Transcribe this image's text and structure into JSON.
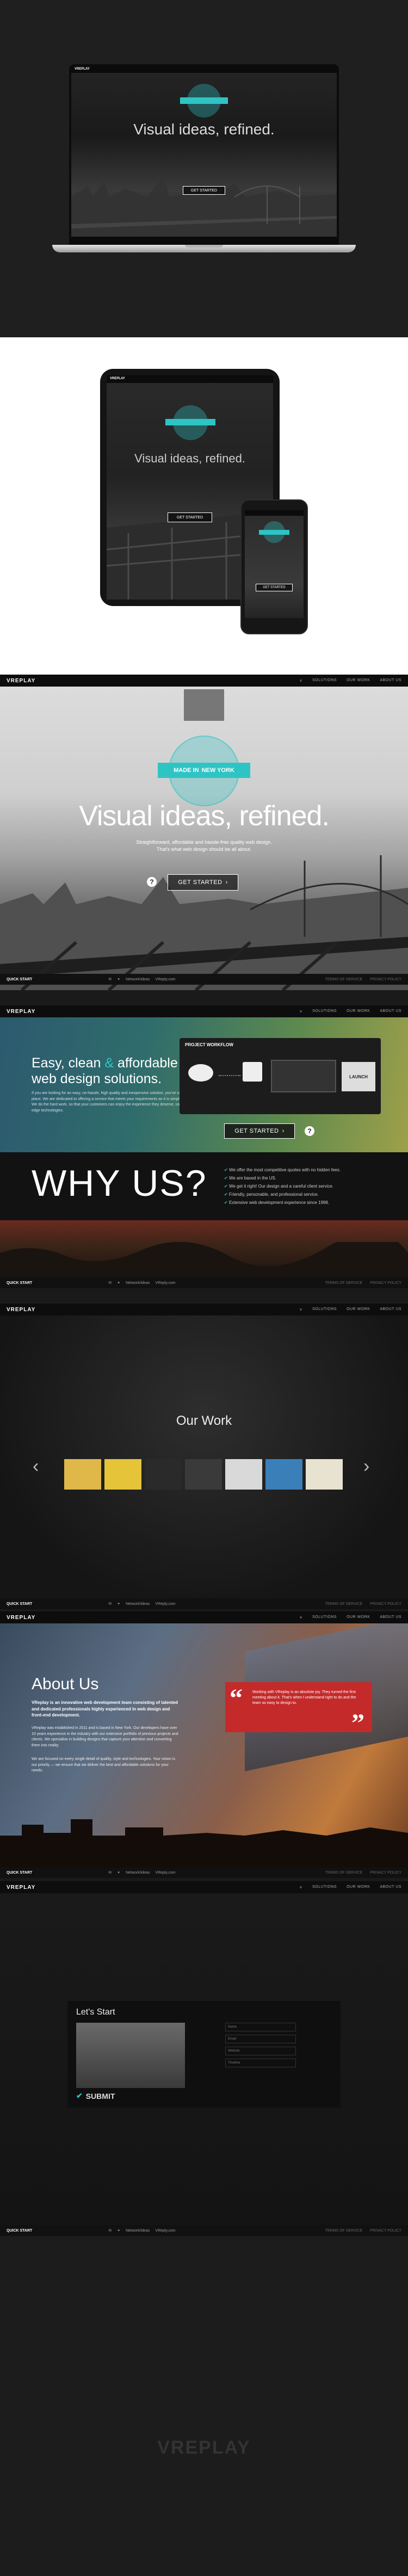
{
  "brand": "VREPLAY",
  "nav": {
    "solutions": "SOLUTIONS",
    "our_work": "OUR WORK",
    "about_us": "ABOUT US",
    "lets_start": "LET'S START"
  },
  "hero": {
    "badge_top": "MADE IN",
    "badge_city": "NEW YORK",
    "headline_a": "Visual ideas,",
    "headline_b": "refined.",
    "subline": "Straightforward, affordable and hassle-free quality web design. That's what web design should be all about.",
    "cta": "GET STARTED"
  },
  "footer_bar": {
    "quick_start": "QUICK START",
    "network1": "Network/ideas",
    "network2": "VReply.com",
    "links": [
      "TERMS OF SERVICE",
      "PRIVACY POLICY"
    ]
  },
  "solutions": {
    "headline_a": "Easy, clean",
    "amp": "&",
    "headline_b": "affordable",
    "headline_c": "web design solutions.",
    "body": "If you are looking for an easy, no-hassle, high quality and inexpensive solution, you've come to the right place. We are dedicated to offering a service that meets your requirements as it is simple as possible. We do the hard work, so that your customers can enjoy the experience they deserve, using cutting-edge technologies.",
    "workflow_title": "PROJECT WORKFLOW",
    "workflow_launch": "LAUNCH",
    "cta": "GET STARTED"
  },
  "why": {
    "title": "WHY US?",
    "items": [
      "We offer the most competitive quotes with no hidden fees.",
      "We are based in the US.",
      "We get it right! Our design and a careful client service.",
      "Friendly, personable, and professional service.",
      "Extensive web development experience since 1998."
    ]
  },
  "work": {
    "title": "Our Work",
    "thumbs": [
      "#e0b84a",
      "#e6c43a",
      "#2a2a2a",
      "#3a3a3a",
      "#d9d9d9",
      "#3b7fb8",
      "#e8e2d0"
    ]
  },
  "about": {
    "title": "About Us",
    "p1": "VReplay is an innovative web development team consisting of talented and dedicated professionals highly experienced in web design and front-end development.",
    "p2": "VReplay was established in 2011 and is based in New York. Our developers have over 10 years experience in the industry with our extensive portfolio of previous projects and clients. We specialise in building designs that capture your attention and converting them into reality.",
    "p3": "We are focused on every single detail of quality, style and technologies. Your vision is our priority — we ensure that we deliver the best and affordable solutions for your needs.",
    "quote": "Working with VReplay is an absolute joy. They turned the first meeting about it. That's when I understand right to do and the team so easy to design to."
  },
  "contact": {
    "title": "Let's Start",
    "fields": [
      "Name",
      "Email",
      "Website",
      "Timeline"
    ],
    "submit": "SUBMIT"
  }
}
